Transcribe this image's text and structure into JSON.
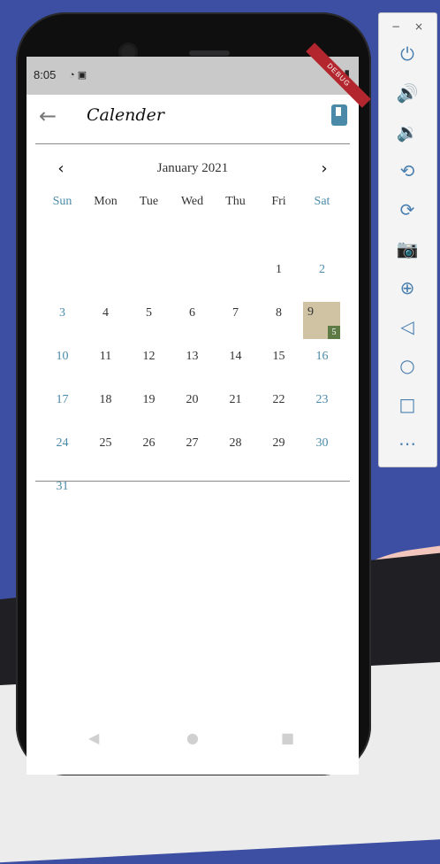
{
  "status": {
    "time": "8:05",
    "left_icons": "◔ ▣",
    "right_icons": "▾ ▮",
    "debug_label": "DEBUG"
  },
  "appbar": {
    "title": "Calender",
    "back_icon": "arrow-left-icon",
    "book_icon": "book-icon"
  },
  "calendar": {
    "month_label": "January 2021",
    "prev_label": "‹",
    "next_label": "›",
    "weekdays": [
      "Sun",
      "Mon",
      "Tue",
      "Wed",
      "Thu",
      "Fri",
      "Sat"
    ],
    "weeks": [
      [
        "",
        "",
        "",
        "",
        "",
        "1",
        "2"
      ],
      [
        "3",
        "4",
        "5",
        "6",
        "7",
        "8",
        "9"
      ],
      [
        "10",
        "11",
        "12",
        "13",
        "14",
        "15",
        "16"
      ],
      [
        "17",
        "18",
        "19",
        "20",
        "21",
        "22",
        "23"
      ],
      [
        "24",
        "25",
        "26",
        "27",
        "28",
        "29",
        "30"
      ],
      [
        "31",
        "",
        "",
        "",
        "",
        "",
        ""
      ]
    ],
    "selected_day": "9",
    "selected_badge": "5",
    "colors": {
      "weekend": "#4a8aa8",
      "selected_bg": "#cfc3a4",
      "badge_bg": "#5e7a45"
    }
  },
  "navbar": {
    "back": "◀",
    "home": "●",
    "recents": "■"
  },
  "emulator_panel": {
    "minimize": "−",
    "close": "×",
    "buttons": [
      "power-icon",
      "volume-up-icon",
      "volume-down-icon",
      "rotate-left-icon",
      "rotate-right-icon",
      "camera-icon",
      "zoom-icon",
      "back-icon",
      "home-icon",
      "overview-icon",
      "more-icon"
    ],
    "glyphs": [
      "⏻",
      "🔊",
      "🔉",
      "⟲",
      "⟳",
      "📷",
      "⊕",
      "◁",
      "○",
      "□",
      "⋯"
    ]
  }
}
